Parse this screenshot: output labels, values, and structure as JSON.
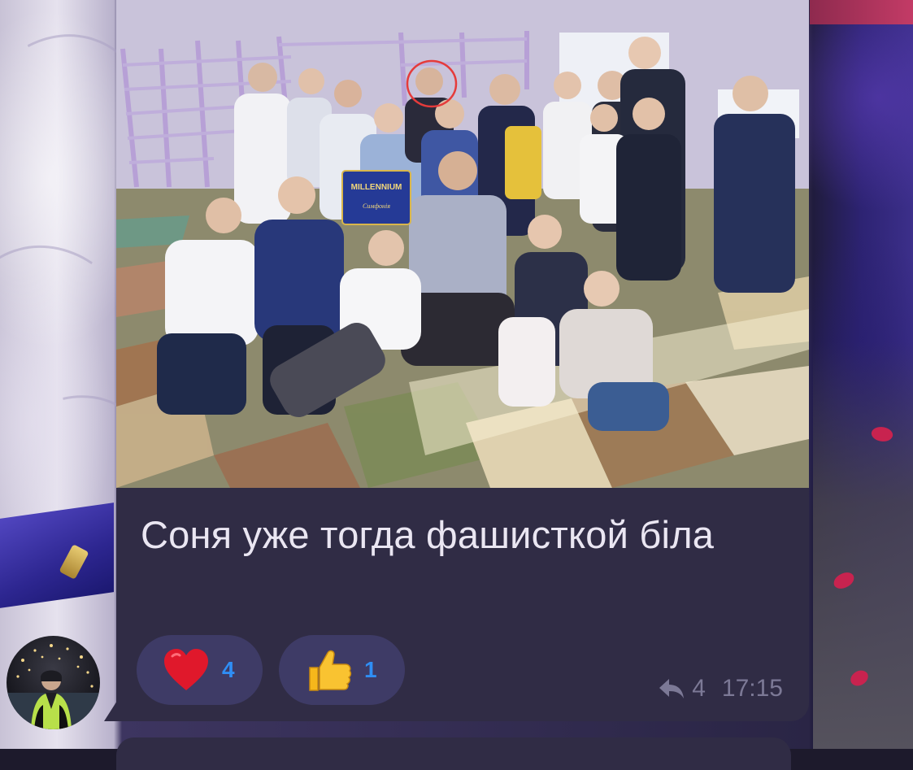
{
  "message": {
    "caption": "Соня уже тогда фашисткой біла",
    "photo_alt": "",
    "reactions": [
      {
        "icon": "heart-icon",
        "count": "4",
        "color": "#e0182b"
      },
      {
        "icon": "thumbs-up-icon",
        "count": "1",
        "color": "#f6b71b"
      }
    ],
    "reply_count": "4",
    "time": "17:15",
    "photo_text": {
      "box_brand": "MILLENNIUM",
      "box_subtitle": "Симфонія"
    }
  },
  "colors": {
    "bubble": "#302c45",
    "reaction_pill": "#3e3b66",
    "count_blue": "#2f8ef5",
    "meta_gray": "#7c7996",
    "caption_text": "#eae6f2"
  }
}
